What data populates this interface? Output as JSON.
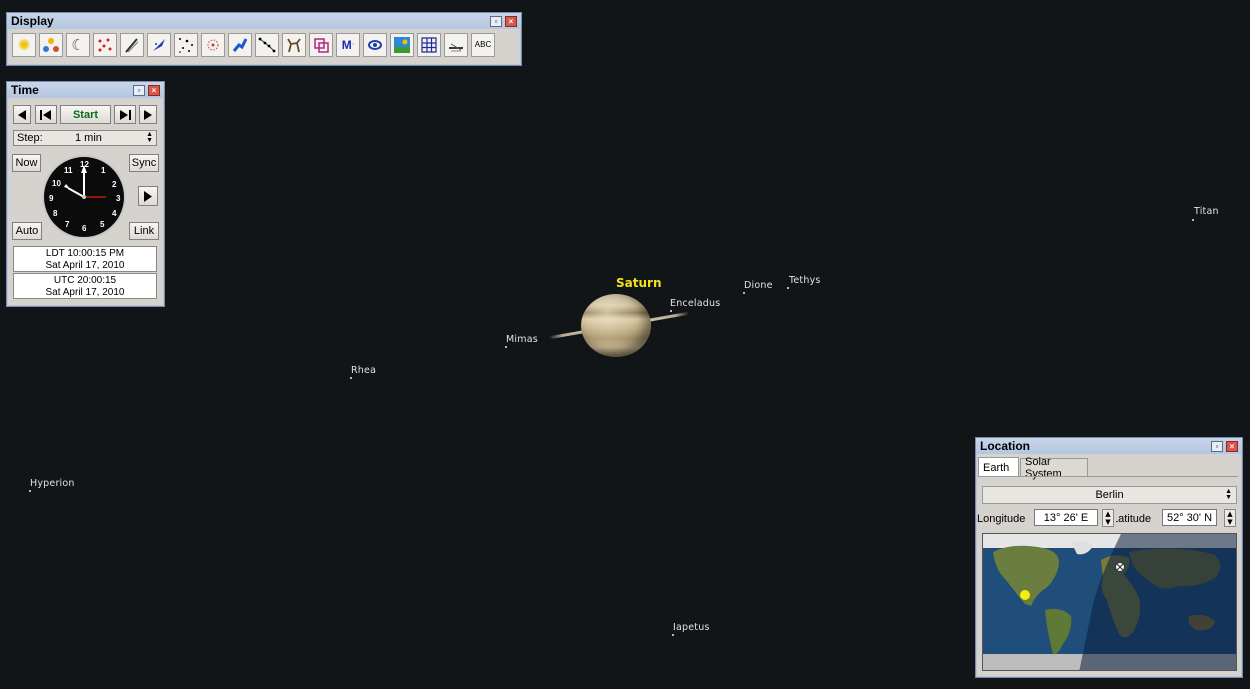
{
  "sky": {
    "planet": "Saturn",
    "moons": [
      {
        "name": "Titan"
      },
      {
        "name": "Tethys"
      },
      {
        "name": "Dione"
      },
      {
        "name": "Enceladus"
      },
      {
        "name": "Mimas"
      },
      {
        "name": "Rhea"
      },
      {
        "name": "Hyperion"
      },
      {
        "name": "Iapetus"
      }
    ],
    "planet_label_color": "#f2e21a",
    "background": "#121517"
  },
  "display_window": {
    "title": "Display",
    "tools": [
      {
        "icon": "sun-icon"
      },
      {
        "icon": "planets-icon"
      },
      {
        "icon": "moon-icon"
      },
      {
        "icon": "asteroids-icon"
      },
      {
        "icon": "comets-icon"
      },
      {
        "icon": "spacecraft-icon"
      },
      {
        "icon": "stars-icon"
      },
      {
        "icon": "star-cluster-icon"
      },
      {
        "icon": "constellation-figures-icon"
      },
      {
        "icon": "constellation-lines-icon"
      },
      {
        "icon": "constellation-art-icon"
      },
      {
        "icon": "constellation-boundaries-icon"
      },
      {
        "icon": "messier-icon"
      },
      {
        "icon": "galaxy-icon"
      },
      {
        "icon": "landscape-icon"
      },
      {
        "icon": "grid-icon"
      },
      {
        "icon": "horizon-icon"
      },
      {
        "icon": "labels-icon"
      }
    ],
    "labels_glyph": "ABC"
  },
  "time_window": {
    "title": "Time",
    "start_label": "Start",
    "step_label": "Step:",
    "step_value": "1 min",
    "now_label": "Now",
    "sync_label": "Sync",
    "auto_label": "Auto",
    "link_label": "Link",
    "clock_numbers": [
      "12",
      "1",
      "2",
      "3",
      "4",
      "5",
      "6",
      "7",
      "8",
      "9",
      "10",
      "11"
    ],
    "local_time": "LDT 10:00:15 PM",
    "local_date": "Sat April 17, 2010",
    "utc_time": "UTC 20:00:15",
    "utc_date": "Sat April 17, 2010"
  },
  "location_window": {
    "title": "Location",
    "tabs": [
      "Earth",
      "Solar System"
    ],
    "city": "Berlin",
    "longitude_label": "Longitude",
    "longitude_value": "13° 26' E",
    "latitude_label": "Latitude",
    "latitude_value": "52° 30' N"
  }
}
